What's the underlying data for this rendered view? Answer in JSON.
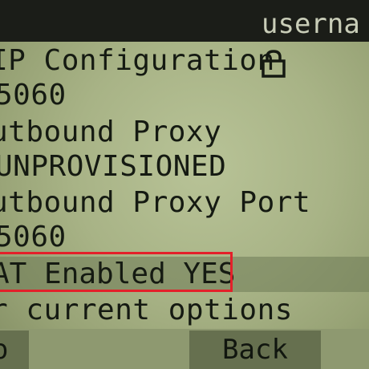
{
  "header": {
    "username": "userna"
  },
  "menu": {
    "title": "IP Configuration",
    "rows": [
      "5060",
      "utbound Proxy",
      "UNPROVISIONED",
      "utbound Proxy Port",
      "5060",
      "AT Enabled YES",
      "r current options"
    ],
    "title_display": "IP Configuration"
  },
  "softkeys": {
    "left": "o",
    "back": "Back"
  },
  "icons": {
    "title": "lock-icon"
  },
  "colors": {
    "lcd": "#a8b386",
    "top_bar": "#1b1d18",
    "highlight_box": "#e3202a",
    "softkey": "#66704f"
  }
}
